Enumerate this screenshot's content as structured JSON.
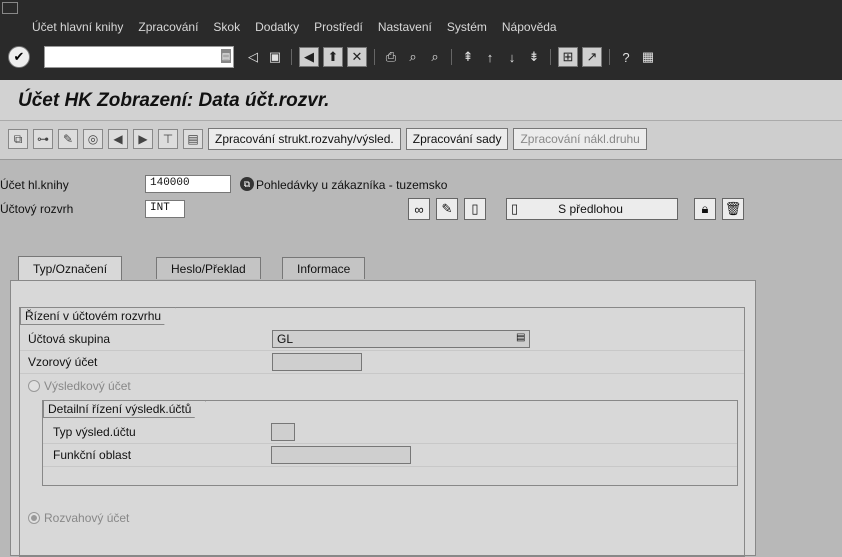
{
  "menu": [
    "Účet hlavní knihy",
    "Zpracování",
    "Skok",
    "Dodatky",
    "Prostředí",
    "Nastavení",
    "Systém",
    "Nápověda"
  ],
  "toolbar": {
    "command_value": "",
    "ok_glyph": "✔",
    "dropdown_glyph": "▤"
  },
  "title": "Účet HK Zobrazení: Data účt.rozvr.",
  "app_buttons": {
    "struct": "Zpracování strukt.rozvahy/výsled.",
    "sets": "Zpracování sady",
    "cost": "Zpracování nákl.druhu"
  },
  "header": {
    "account_label": "Účet hl.knihy",
    "account_value": "140000",
    "account_desc": "Pohledávky u zákazníka - tuzemsko",
    "chart_label": "Účtový rozvrh",
    "chart_value": "INT",
    "with_template_label": "S předlohou"
  },
  "tabs": [
    "Typ/Označení",
    "Heslo/Překlad",
    "Informace"
  ],
  "group1": {
    "title": "Řízení v účtovém rozvrhu",
    "account_group_label": "Účtová skupina",
    "account_group_value": "GL",
    "sample_account_label": "Vzorový účet",
    "pl_account_label": "Výsledkový účet"
  },
  "group2": {
    "title": "Detailní řízení výsledk.účtů",
    "pl_type_label": "Typ výsled.účtu",
    "func_area_label": "Funkční oblast"
  },
  "balance_sheet_label": "Rozvahový účet"
}
